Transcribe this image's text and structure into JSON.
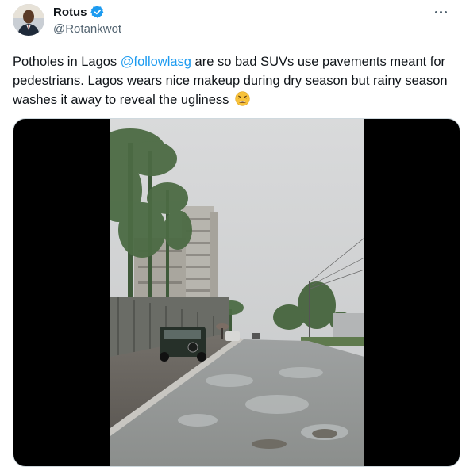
{
  "author": {
    "name": "Rotus",
    "handle": "@Rotankwot",
    "verified": true
  },
  "tweet": {
    "text_before": "Potholes in Lagos ",
    "mention": "@followlasg",
    "text_after": " are so bad SUVs use pavements meant for pedestrians. Lagos wears nice makeup during dry season but rainy season washes it away to reveal the ugliness",
    "emoji": "tired-face-emoji"
  },
  "media": {
    "type": "video",
    "description_icon": "video-still"
  },
  "colors": {
    "link": "#1d9bf0",
    "verified": "#1d9bf0",
    "secondary_text": "#536471",
    "media_background": "#000000"
  }
}
